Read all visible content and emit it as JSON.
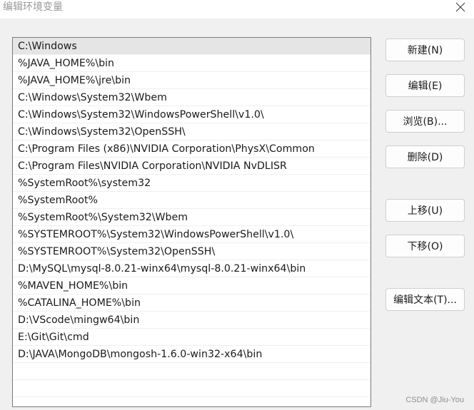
{
  "window": {
    "title": "编辑环境变量",
    "close_icon": "close-icon"
  },
  "paths": [
    "C:\\Windows",
    "%JAVA_HOME%\\bin",
    "%JAVA_HOME%\\jre\\bin",
    "C:\\Windows\\System32\\Wbem",
    "C:\\Windows\\System32\\WindowsPowerShell\\v1.0\\",
    "C:\\Windows\\System32\\OpenSSH\\",
    "C:\\Program Files (x86)\\NVIDIA Corporation\\PhysX\\Common",
    "C:\\Program Files\\NVIDIA Corporation\\NVIDIA NvDLISR",
    "%SystemRoot%\\system32",
    "%SystemRoot%",
    "%SystemRoot%\\System32\\Wbem",
    "%SYSTEMROOT%\\System32\\WindowsPowerShell\\v1.0\\",
    "%SYSTEMROOT%\\System32\\OpenSSH\\",
    "D:\\MySQL\\mysql-8.0.21-winx64\\mysql-8.0.21-winx64\\bin",
    "%MAVEN_HOME%\\bin",
    "%CATALINA_HOME%\\bin",
    "D:\\VScode\\mingw64\\bin",
    "E:\\Git\\Git\\cmd",
    "D:\\JAVA\\MongoDB\\mongosh-1.6.0-win32-x64\\bin"
  ],
  "selected_index": 0,
  "buttons": {
    "new": "新建(N)",
    "edit": "编辑(E)",
    "browse": "浏览(B)...",
    "delete": "删除(D)",
    "move_up": "上移(U)",
    "move_down": "下移(O)",
    "edit_text": "编辑文本(T)..."
  },
  "watermark": "CSDN @Jiu-You"
}
